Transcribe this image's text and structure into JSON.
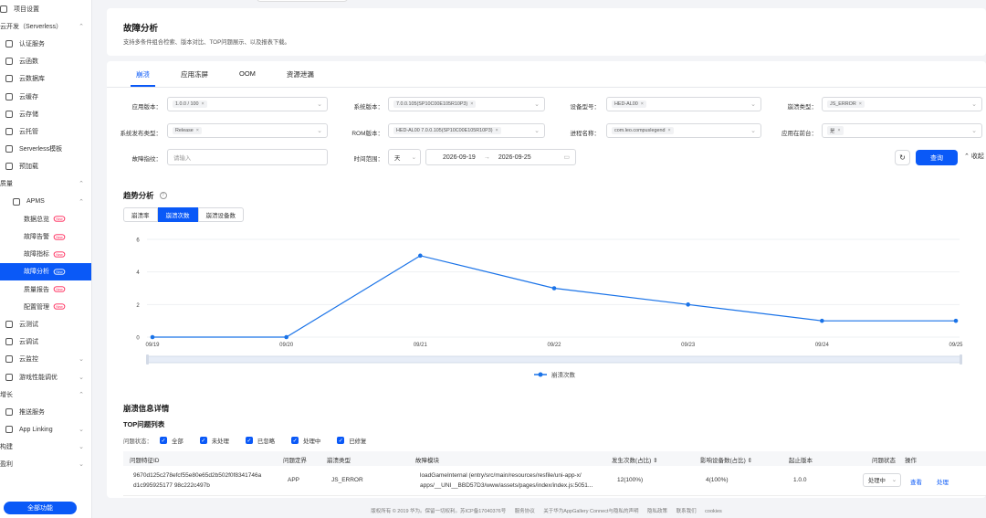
{
  "sidebar": {
    "items": [
      {
        "label": "项目设置",
        "lvl": 0,
        "icon": "settings-icon",
        "chev": "",
        "new": false,
        "active": false
      },
      {
        "label": "云开发（Serverless）",
        "lvl": 0,
        "icon": "",
        "chev": "⌃",
        "new": false,
        "active": false
      },
      {
        "label": "认证服务",
        "lvl": 1,
        "icon": "shield-icon",
        "chev": "",
        "new": false,
        "active": false
      },
      {
        "label": "云函数",
        "lvl": 1,
        "icon": "function-icon",
        "chev": "",
        "new": false,
        "active": false
      },
      {
        "label": "云数据库",
        "lvl": 1,
        "icon": "database-icon",
        "chev": "",
        "new": false,
        "active": false
      },
      {
        "label": "云缓存",
        "lvl": 1,
        "icon": "cache-icon",
        "chev": "",
        "new": false,
        "active": false
      },
      {
        "label": "云存储",
        "lvl": 1,
        "icon": "storage-icon",
        "chev": "",
        "new": false,
        "active": false
      },
      {
        "label": "云托管",
        "lvl": 1,
        "icon": "hosting-icon",
        "chev": "",
        "new": false,
        "active": false
      },
      {
        "label": "Serverless模板",
        "lvl": 1,
        "icon": "template-icon",
        "chev": "",
        "new": false,
        "active": false
      },
      {
        "label": "预加载",
        "lvl": 1,
        "icon": "preload-icon",
        "chev": "",
        "new": false,
        "active": false
      },
      {
        "label": "质量",
        "lvl": 0,
        "icon": "",
        "chev": "⌃",
        "new": false,
        "active": false
      },
      {
        "label": "APMS",
        "lvl": 2,
        "icon": "apms-icon",
        "chev": "⌃",
        "new": false,
        "active": false
      },
      {
        "label": "数据总览",
        "lvl": 3,
        "icon": "",
        "chev": "",
        "new": true,
        "active": false
      },
      {
        "label": "故障告警",
        "lvl": 3,
        "icon": "",
        "chev": "",
        "new": true,
        "active": false
      },
      {
        "label": "故障指标",
        "lvl": 3,
        "icon": "",
        "chev": "",
        "new": true,
        "active": false
      },
      {
        "label": "故障分析",
        "lvl": 3,
        "icon": "",
        "chev": "",
        "new": true,
        "active": true
      },
      {
        "label": "质量报告",
        "lvl": 3,
        "icon": "",
        "chev": "",
        "new": true,
        "active": false
      },
      {
        "label": "配置管理",
        "lvl": 3,
        "icon": "",
        "chev": "",
        "new": true,
        "active": false
      },
      {
        "label": "云测试",
        "lvl": 1,
        "icon": "test-icon",
        "chev": "",
        "new": false,
        "active": false
      },
      {
        "label": "云调试",
        "lvl": 1,
        "icon": "debug-icon",
        "chev": "",
        "new": false,
        "active": false
      },
      {
        "label": "云监控",
        "lvl": 1,
        "icon": "monitor-icon",
        "chev": "⌄",
        "new": false,
        "active": false
      },
      {
        "label": "游戏性能调优",
        "lvl": 1,
        "icon": "game-icon",
        "chev": "⌄",
        "new": false,
        "active": false
      },
      {
        "label": "增长",
        "lvl": 0,
        "icon": "",
        "chev": "⌃",
        "new": false,
        "active": false
      },
      {
        "label": "推送服务",
        "lvl": 1,
        "icon": "push-icon",
        "chev": "",
        "new": false,
        "active": false
      },
      {
        "label": "App Linking",
        "lvl": 1,
        "icon": "link-icon",
        "chev": "⌄",
        "new": false,
        "active": false
      },
      {
        "label": "构建",
        "lvl": 0,
        "icon": "",
        "chev": "⌄",
        "new": false,
        "active": false
      },
      {
        "label": "盈利",
        "lvl": 0,
        "icon": "",
        "chev": "⌄",
        "new": false,
        "active": false
      }
    ],
    "new_badge": "New",
    "all_functions": "全部功能"
  },
  "header": {
    "title": "故障分析",
    "subtitle": "支持多条件组合检索、版本对比、TOP问题展示、以及报表下载。"
  },
  "tabs": [
    {
      "label": "崩溃",
      "active": true
    },
    {
      "label": "应用冻屏",
      "active": false
    },
    {
      "label": "OOM",
      "active": false
    },
    {
      "label": "资源泄漏",
      "active": false
    }
  ],
  "filters": {
    "app_version": {
      "label": "应用版本：",
      "tag": "1.0.0 / 100"
    },
    "sys_version": {
      "label": "系统版本：",
      "tag": "7.0.0.105(SP10C00E105R10P3)"
    },
    "device_model": {
      "label": "设备型号：",
      "tag": "HED-AL00"
    },
    "crash_type": {
      "label": "崩溃类型：",
      "tag": "JS_ERROR"
    },
    "release_type": {
      "label": "系统发布类型：",
      "tag": "Release"
    },
    "rom_version": {
      "label": "ROM版本：",
      "tag": "HED-AL00 7.0.0.105(SP10C00E105R10P3)"
    },
    "process_name": {
      "label": "进程名称：",
      "tag": "com.leo.compuslegend"
    },
    "foreground": {
      "label": "应用在前台：",
      "tag": "是"
    },
    "fingerprint": {
      "label": "故障指纹：",
      "placeholder": "请输入"
    },
    "time_range": {
      "label": "时间范围：",
      "unit": "天",
      "start": "2026-09-19",
      "arrow": "→",
      "end": "2026-09-25"
    }
  },
  "buttons": {
    "query": "查询",
    "collapse": "收起",
    "refresh_icon": "refresh-icon"
  },
  "trend": {
    "title": "趋势分析",
    "help": "?",
    "metrics": [
      {
        "label": "崩溃率",
        "active": false
      },
      {
        "label": "崩溃次数",
        "active": true
      },
      {
        "label": "崩溃设备数",
        "active": false
      }
    ]
  },
  "chart_data": {
    "type": "line",
    "x": [
      "09/19",
      "09/20",
      "09/21",
      "09/22",
      "09/23",
      "09/24",
      "09/25"
    ],
    "series": [
      {
        "name": "崩溃次数",
        "values": [
          0,
          0,
          5,
          3,
          2,
          1,
          1
        ],
        "color": "#1a73e8"
      }
    ],
    "yticks": [
      0,
      2,
      4,
      6
    ],
    "ylim": [
      0,
      6
    ],
    "grid": true,
    "legend": "bottom-center"
  },
  "details": {
    "title": "崩溃信息详情",
    "top_title": "TOP问题列表",
    "status_label": "问题状态：",
    "status_checks": [
      "全部",
      "未处理",
      "已忽略",
      "处理中",
      "已修复"
    ],
    "columns": [
      "问题特征ID",
      "问题定界",
      "崩溃类型",
      "故障模块",
      "发生次数(占比)",
      "影响设备数(占比)",
      "起止版本",
      "问题状态",
      "操作"
    ],
    "sort_icon": "⇕",
    "rows": [
      {
        "id_line1": "9670d125c278efcf55e80e65d2b502f0f8341746a",
        "id_line2": "d1c995925177 98c222c497b",
        "scope": "APP",
        "crash_type": "JS_ERROR",
        "module_line1": "loadGameInternal (entry/src/main/resources/resfile/uni-app-x/",
        "module_line2": "apps/__UNI__BBD57D3/www/assets/pages/index/index.js:5051...",
        "count": "12(100%)",
        "devices": "4(100%)",
        "version": "1.0.0",
        "status": "处理中",
        "action_view": "查看",
        "action_handle": "处理"
      }
    ]
  },
  "footer": [
    "版权所有 © 2019 华为。保留一切权利。苏ICP备17040376号",
    "服务协议",
    "关于华为AppGallery Connect与隐私的声明",
    "隐私政策",
    "联系我们",
    "cookies"
  ]
}
